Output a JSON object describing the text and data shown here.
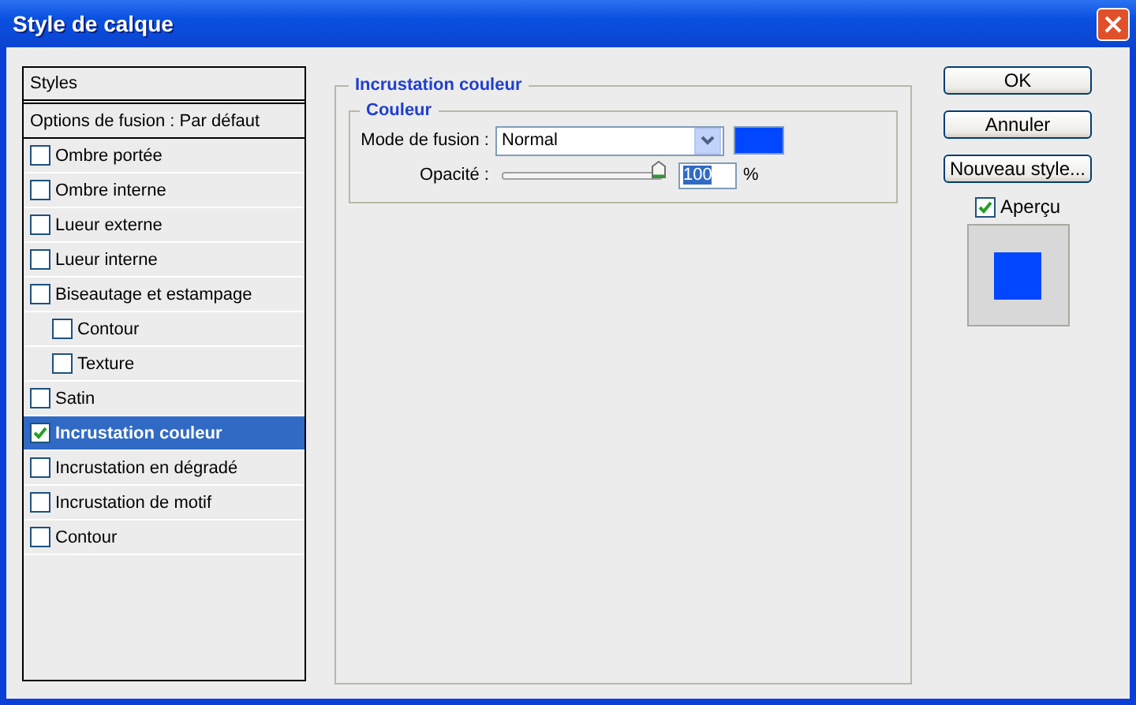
{
  "window": {
    "title": "Style de calque"
  },
  "sidebar": {
    "header": "Styles",
    "items": [
      {
        "label": "Options de fusion : Par défaut",
        "kind": "plain",
        "selected": false
      },
      {
        "label": "Ombre portée",
        "kind": "check",
        "checked": false,
        "selected": false
      },
      {
        "label": "Ombre interne",
        "kind": "check",
        "checked": false,
        "selected": false
      },
      {
        "label": "Lueur externe",
        "kind": "check",
        "checked": false,
        "selected": false
      },
      {
        "label": "Lueur interne",
        "kind": "check",
        "checked": false,
        "selected": false
      },
      {
        "label": "Biseautage et estampage",
        "kind": "check",
        "checked": false,
        "selected": false,
        "children": [
          {
            "label": "Contour",
            "kind": "check",
            "checked": false,
            "selected": false
          },
          {
            "label": "Texture",
            "kind": "check",
            "checked": false,
            "selected": false
          }
        ]
      },
      {
        "label": "Satin",
        "kind": "check",
        "checked": false,
        "selected": false
      },
      {
        "label": "Incrustation couleur",
        "kind": "check",
        "checked": true,
        "selected": true
      },
      {
        "label": "Incrustation en dégradé",
        "kind": "check",
        "checked": false,
        "selected": false
      },
      {
        "label": "Incrustation de motif",
        "kind": "check",
        "checked": false,
        "selected": false
      },
      {
        "label": "Contour",
        "kind": "check",
        "checked": false,
        "selected": false
      }
    ]
  },
  "panel": {
    "title": "Incrustation couleur",
    "group": "Couleur",
    "blend_label": "Mode de fusion :",
    "blend_value": "Normal",
    "color": "#0047ff",
    "opacity_label": "Opacité :",
    "opacity": {
      "level": 1,
      "value": "100",
      "unit": "%"
    }
  },
  "buttons": [
    "OK",
    "Annuler",
    "Nouveau style..."
  ],
  "preview": {
    "label": "Aperçu",
    "checked": true
  }
}
